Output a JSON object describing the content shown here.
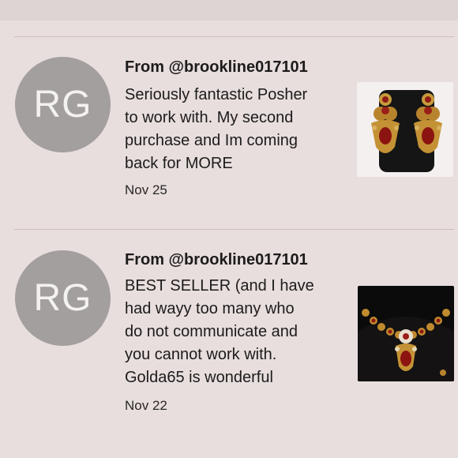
{
  "reviews": [
    {
      "initials": "RG",
      "from": "From @brookline017101",
      "lines": [
        "Seriously fantastic Posher",
        "to work with. My second",
        "purchase and Im coming",
        "back for MORE"
      ],
      "date": "Nov 25",
      "image_icon": "earrings-photo"
    },
    {
      "initials": "RG",
      "from": "From @brookline017101",
      "lines": [
        "BEST SELLER (and I have",
        "had wayy too many who",
        "do not communicate and",
        "you cannot work with.",
        "Golda65 is wonderful"
      ],
      "date": "Nov 22",
      "image_icon": "necklace-photo"
    }
  ],
  "colors": {
    "background": "#e7dedd",
    "avatar": "#a39f9e",
    "text": "#1d1b1b"
  }
}
